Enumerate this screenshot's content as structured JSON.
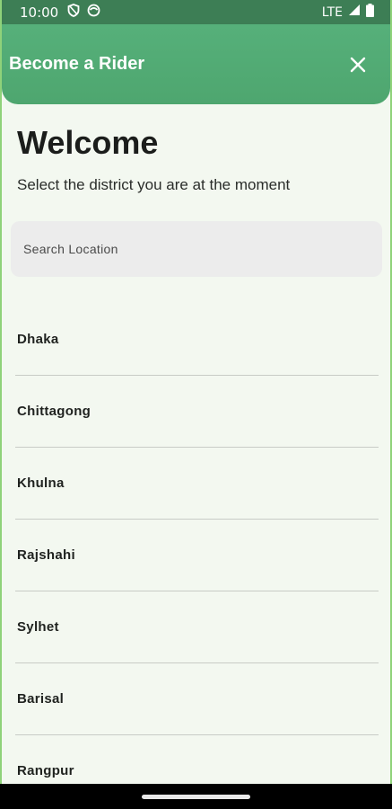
{
  "status_bar": {
    "time": "10:00",
    "network": "LTE",
    "icons": [
      "shield-icon",
      "circle-app-icon",
      "signal-icon",
      "battery-icon"
    ]
  },
  "appbar": {
    "title": "Become a Rider",
    "close_icon": "close-icon"
  },
  "main": {
    "heading": "Welcome",
    "subtitle": "Select the district you are at the moment"
  },
  "search": {
    "placeholder": "Search Location",
    "value": ""
  },
  "districts": [
    {
      "label": "Dhaka"
    },
    {
      "label": "Chittagong"
    },
    {
      "label": "Khulna"
    },
    {
      "label": "Rajshahi"
    },
    {
      "label": "Sylhet"
    },
    {
      "label": "Barisal"
    },
    {
      "label": "Rangpur"
    }
  ],
  "colors": {
    "status_bar": "#3d7e55",
    "appbar": "#4ea66f",
    "background": "#f3f8f0"
  }
}
